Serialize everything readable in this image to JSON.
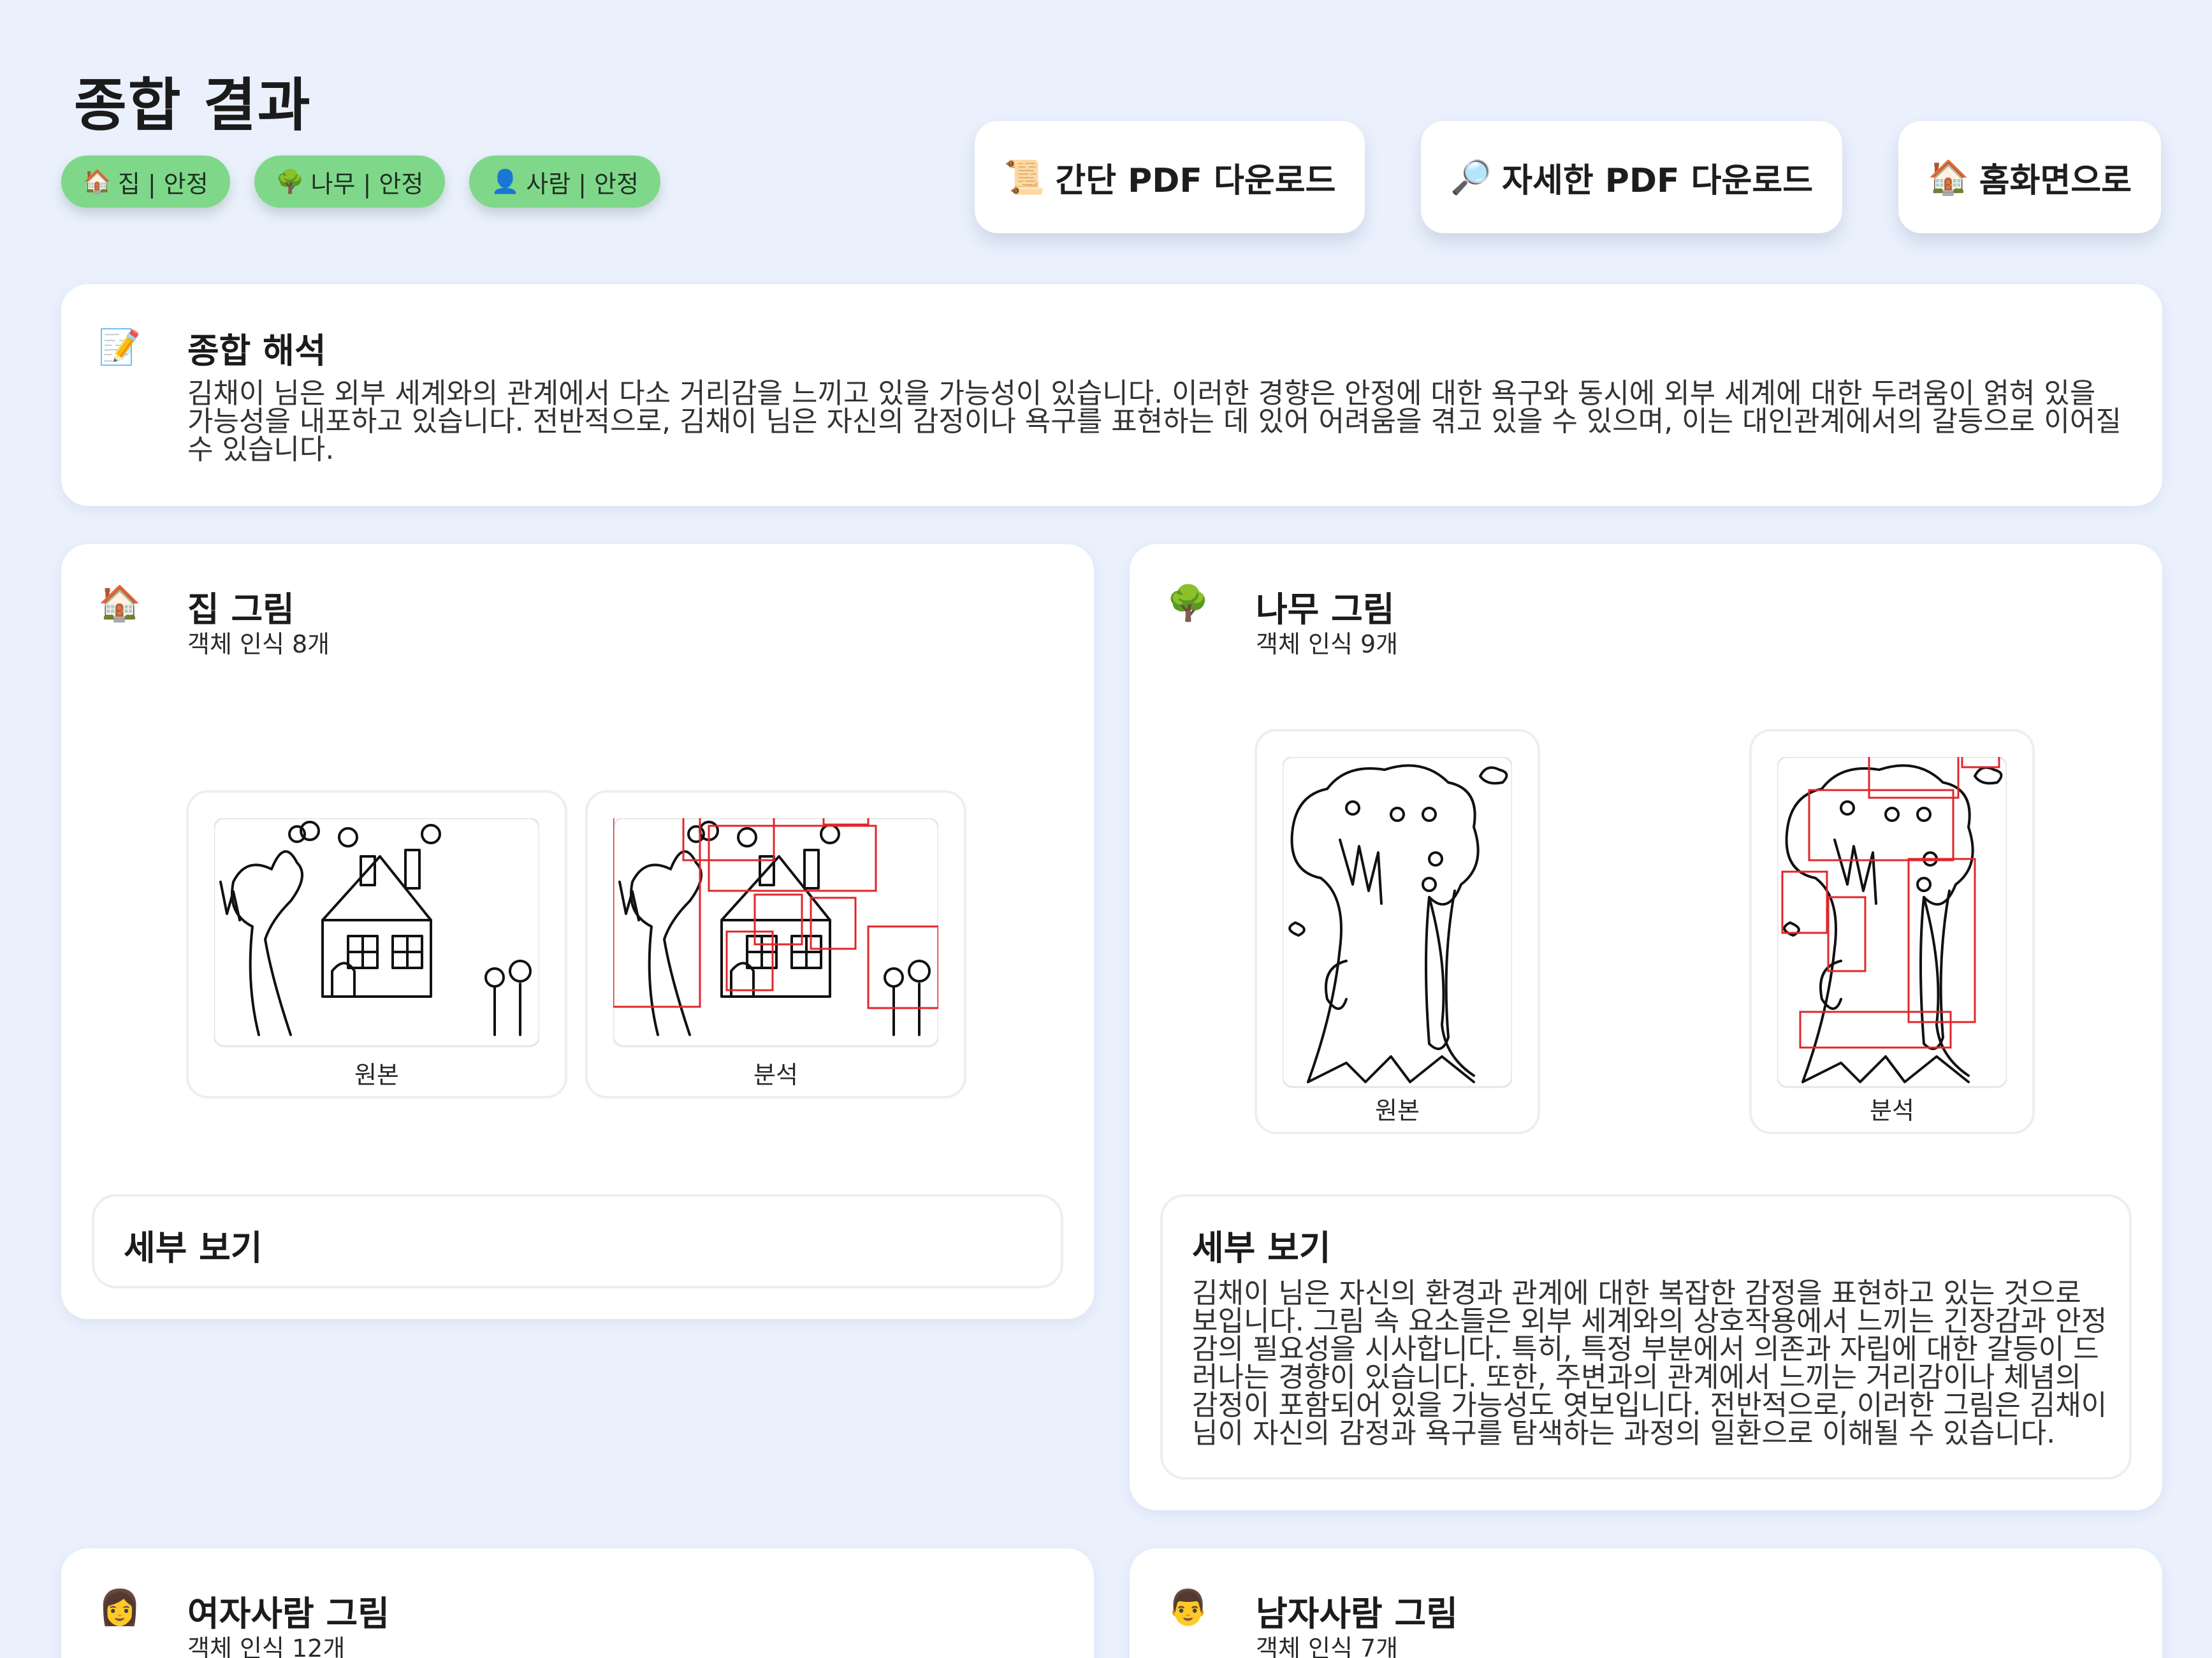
{
  "page": {
    "title": "종합 결과"
  },
  "chips": [
    {
      "icon": "🏠",
      "label": "집 | 안정"
    },
    {
      "icon": "🌳",
      "label": "나무 | 안정"
    },
    {
      "icon": "👤",
      "label": "사람 | 안정"
    }
  ],
  "actions": {
    "simple_pdf": {
      "icon": "📜",
      "label": "간단 PDF 다운로드"
    },
    "detail_pdf": {
      "icon": "🔎",
      "label": "자세한 PDF 다운로드"
    },
    "home": {
      "icon": "🏠",
      "label": "홈화면으로"
    }
  },
  "summary": {
    "icon": "📝",
    "title": "종합 해석",
    "text": "김채이 님은 외부 세계와의 관계에서 다소 거리감을 느끼고 있을 가능성이 있습니다. 이러한 경향은 안정에 대한 욕구와 동시에 외부 세계에 대한 두려움이 얽혀 있을 가능성을 내포하고 있습니다. 전반적으로, 김채이 님은 자신의 감정이나 욕구를 표현하는 데 있어 어려움을 겪고 있을 수 있으며, 이는 대인관계에서의 갈등으로 이어질 수 있습니다."
  },
  "house": {
    "icon": "🏠",
    "title": "집 그림",
    "count": "객체 인식 8개",
    "original_caption": "원본",
    "analysis_caption": "분석",
    "detail_title": "세부 보기",
    "detail_text": ""
  },
  "tree": {
    "icon": "🌳",
    "title": "나무 그림",
    "count": "객체 인식 9개",
    "original_caption": "원본",
    "analysis_caption": "분석",
    "detail_title": "세부 보기",
    "detail_text": "김채이 님은 자신의 환경과 관계에 대한 복잡한 감정을 표현하고 있는 것으로 보입니다. 그림 속 요소들은 외부 세계와의 상호작용에서 느끼는 긴장감과 안정감의 필요성을 시사합니다. 특히, 특정 부분에서 의존과 자립에 대한 갈등이 드러나는 경향이 있습니다. 또한, 주변과의 관계에서 느끼는 거리감이나 체념의 감정이 포함되어 있을 가능성도 엿보입니다. 전반적으로, 이러한 그림은 김채이 님이 자신의 감정과 욕구를 탐색하는 과정의 일환으로 이해될 수 있습니다."
  },
  "woman": {
    "icon": "👩",
    "title": "여자사람 그림",
    "count": "객체 인식 12개"
  },
  "man": {
    "icon": "👨",
    "title": "남자사람 그림",
    "count": "객체 인식 7개"
  }
}
